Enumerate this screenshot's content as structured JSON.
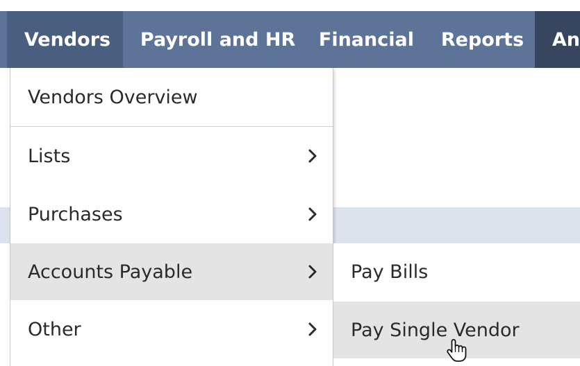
{
  "navbar": {
    "items": [
      {
        "label": "Vendors",
        "state": "active"
      },
      {
        "label": "Payroll and HR"
      },
      {
        "label": "Financial"
      },
      {
        "label": "Reports"
      },
      {
        "label": "An"
      }
    ]
  },
  "vendors_menu": {
    "items": [
      {
        "label": "Vendors Overview",
        "has_submenu": false
      },
      {
        "label": "Lists",
        "has_submenu": true,
        "icon": "chevron-right-icon"
      },
      {
        "label": "Purchases",
        "has_submenu": true,
        "icon": "chevron-right-icon"
      },
      {
        "label": "Accounts Payable",
        "has_submenu": true,
        "icon": "chevron-right-icon",
        "state": "highlighted"
      },
      {
        "label": "Other",
        "has_submenu": true,
        "icon": "chevron-right-icon"
      }
    ]
  },
  "accounts_payable_submenu": {
    "items": [
      {
        "label": "Pay Bills"
      },
      {
        "label": "Pay Single Vendor",
        "state": "hovered"
      }
    ]
  },
  "cursor": {
    "icon": "hand-pointer-icon"
  },
  "colors": {
    "navbar_bg": "#5d7397",
    "navbar_active": "#4a5f80",
    "navbar_dark": "#37455e",
    "menu_highlight": "#e4e4e4",
    "text": "#2a2a2a"
  }
}
